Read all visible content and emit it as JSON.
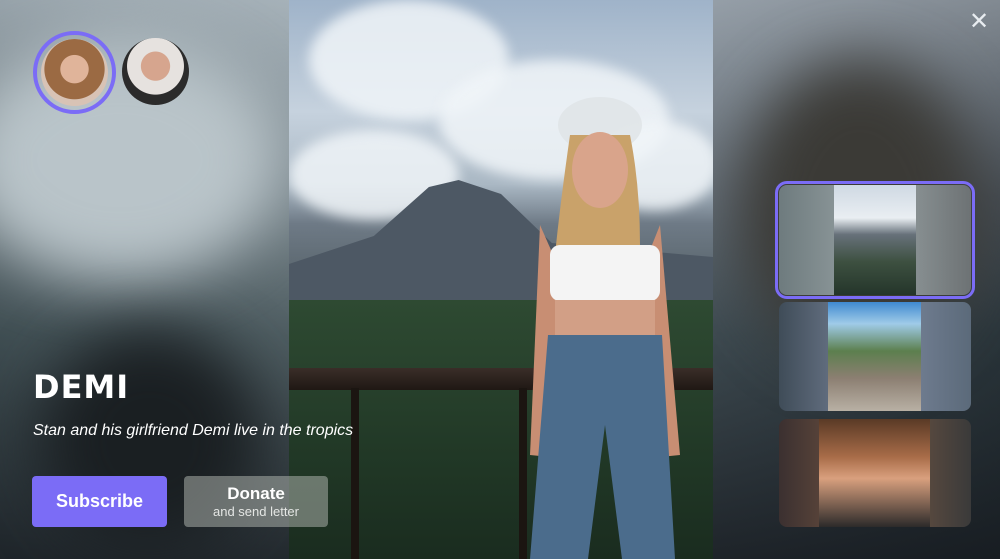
{
  "profile": {
    "name": "DEMI",
    "description": "Stan and his girlfriend Demi live in the tropics"
  },
  "avatars": [
    {
      "icon": "avatar-demi",
      "selected": true
    },
    {
      "icon": "avatar-stan",
      "selected": false
    }
  ],
  "actions": {
    "subscribe_label": "Subscribe",
    "donate_label": "Donate",
    "donate_sublabel": "and send letter"
  },
  "controls": {
    "close_glyph": "✕"
  },
  "colors": {
    "accent": "#7b6cf6",
    "donate_bg": "#9ca09c",
    "text": "#ffffff"
  },
  "thumbnails": [
    {
      "icon": "photo-thumbnail",
      "selected": true
    },
    {
      "icon": "photo-thumbnail",
      "selected": false
    },
    {
      "icon": "photo-thumbnail",
      "selected": false
    }
  ]
}
